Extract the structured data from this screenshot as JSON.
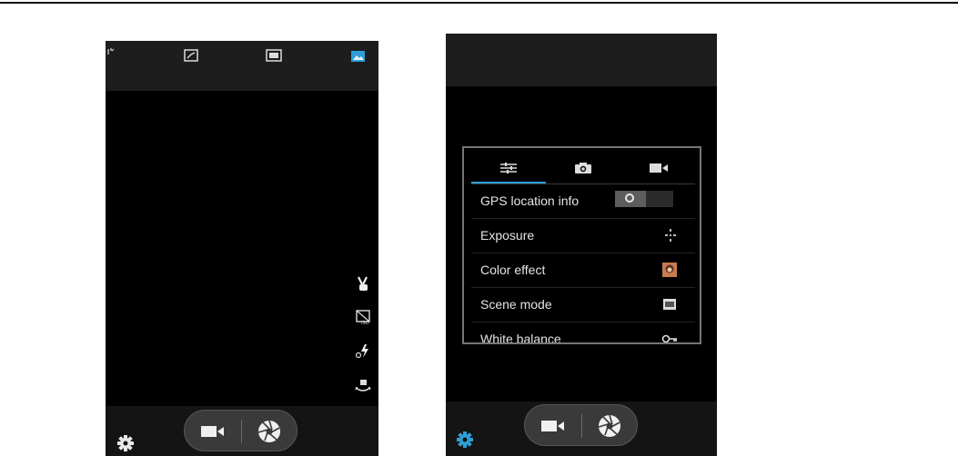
{
  "left_screen": {
    "top_bar_icons": [
      "panorama-mode-icon",
      "camera-mode-icon",
      "picture-mode-icon"
    ],
    "side_icons": [
      "gesture-shot-icon",
      "hdr-icon",
      "flash-icon",
      "switch-camera-icon"
    ],
    "settings_icon": "gear-icon",
    "bottom_controls": [
      "video-record-icon",
      "shutter-icon"
    ]
  },
  "right_screen": {
    "settings_panel": {
      "tabs": [
        {
          "icon": "sliders-icon",
          "selected": true
        },
        {
          "icon": "camera-icon",
          "selected": false
        },
        {
          "icon": "video-icon",
          "selected": false
        }
      ],
      "items": [
        {
          "label": "GPS location info",
          "control": "toggle-off"
        },
        {
          "label": "Exposure",
          "control": "exposure-icon"
        },
        {
          "label": "Color effect",
          "control": "color-effect-icon"
        },
        {
          "label": "Scene mode",
          "control": "scene-icon"
        },
        {
          "label": "White balance",
          "control": "white-balance-icon"
        }
      ]
    },
    "settings_icon": "gear-icon",
    "bottom_controls": [
      "video-record-icon",
      "shutter-icon"
    ]
  },
  "colors": {
    "accent": "#2f9fd6",
    "panel_border": "#767676",
    "bar": "#1d1d1d"
  }
}
